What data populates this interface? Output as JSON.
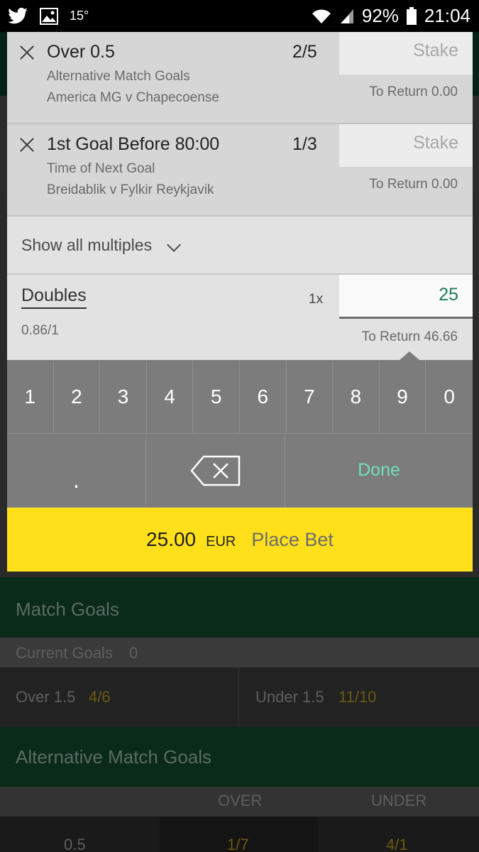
{
  "status_bar": {
    "temperature": "15°",
    "battery_percent": "92%",
    "time": "21:04",
    "icons": [
      "twitter-icon",
      "image-icon",
      "wifi-icon",
      "signal-icon",
      "battery-icon"
    ]
  },
  "selections": [
    {
      "name": "Over 0.5",
      "odds": "2/5",
      "market": "Alternative Match Goals",
      "match": "America MG v Chapecoense",
      "stake_placeholder": "Stake",
      "to_return": "To Return 0.00"
    },
    {
      "name": "1st Goal Before 80:00",
      "odds": "1/3",
      "market": "Time of Next Goal",
      "match": "Breidablik v Fylkir Reykjavik",
      "stake_placeholder": "Stake",
      "to_return": "To Return 0.00"
    }
  ],
  "multiples_toggle": "Show all multiples",
  "doubles": {
    "title": "Doubles",
    "multiplier": "1x",
    "stake_value": "25",
    "odds": "0.86/1",
    "to_return": "To Return 46.66"
  },
  "keypad": {
    "digits": [
      "1",
      "2",
      "3",
      "4",
      "5",
      "6",
      "7",
      "8",
      "9",
      "0"
    ],
    "dot": ".",
    "done": "Done"
  },
  "place_bet": {
    "amount": "25.00",
    "currency": "EUR",
    "label": "Place Bet"
  },
  "background": {
    "match_goals_title": "Match Goals",
    "current_goals_label": "Current Goals",
    "current_goals_value": "0",
    "over_label": "Over 1.5",
    "over_odds": "4/6",
    "under_label": "Under 1.5",
    "under_odds": "11/10",
    "alt_match_goals_title": "Alternative Match Goals",
    "col_over": "OVER",
    "col_under": "UNDER",
    "row_line": "0.5",
    "row_over_odds": "1/7",
    "row_under_odds": "4/1"
  },
  "colors": {
    "place_bet_bg": "#ffe01b",
    "done_text": "#6ee0b8",
    "stake_value_text": "#1f7a55",
    "keypad_bg": "#7c7c7c"
  }
}
